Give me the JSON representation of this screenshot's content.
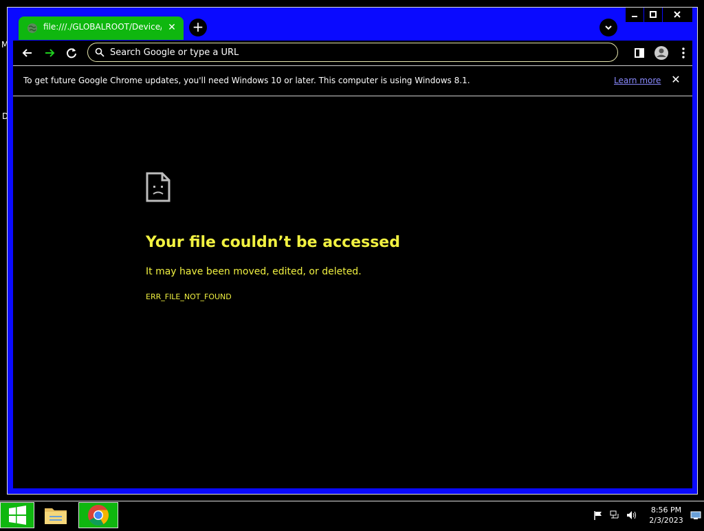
{
  "desktop": {
    "letters": [
      "M",
      "D"
    ]
  },
  "browser": {
    "tab": {
      "title": "file:///./GLOBALROOT/Device/Cor"
    },
    "omnibox": {
      "placeholder": "Search Google or type a URL",
      "value": ""
    },
    "infobar": {
      "text": "To get future Google Chrome updates, you'll need Windows 10 or later. This computer is using Windows 8.1.",
      "link": "Learn more"
    },
    "error": {
      "title": "Your file couldn’t be accessed",
      "subtitle": "It may have been moved, edited, or deleted.",
      "code": "ERR_FILE_NOT_FOUND"
    }
  },
  "taskbar": {
    "clock": {
      "time": "8:56 PM",
      "date": "2/3/2023"
    }
  },
  "colors": {
    "window_frame": "#0a0aff",
    "tab_active": "#0fb70f",
    "error_text": "#f1f141",
    "link": "#8a8aff"
  }
}
